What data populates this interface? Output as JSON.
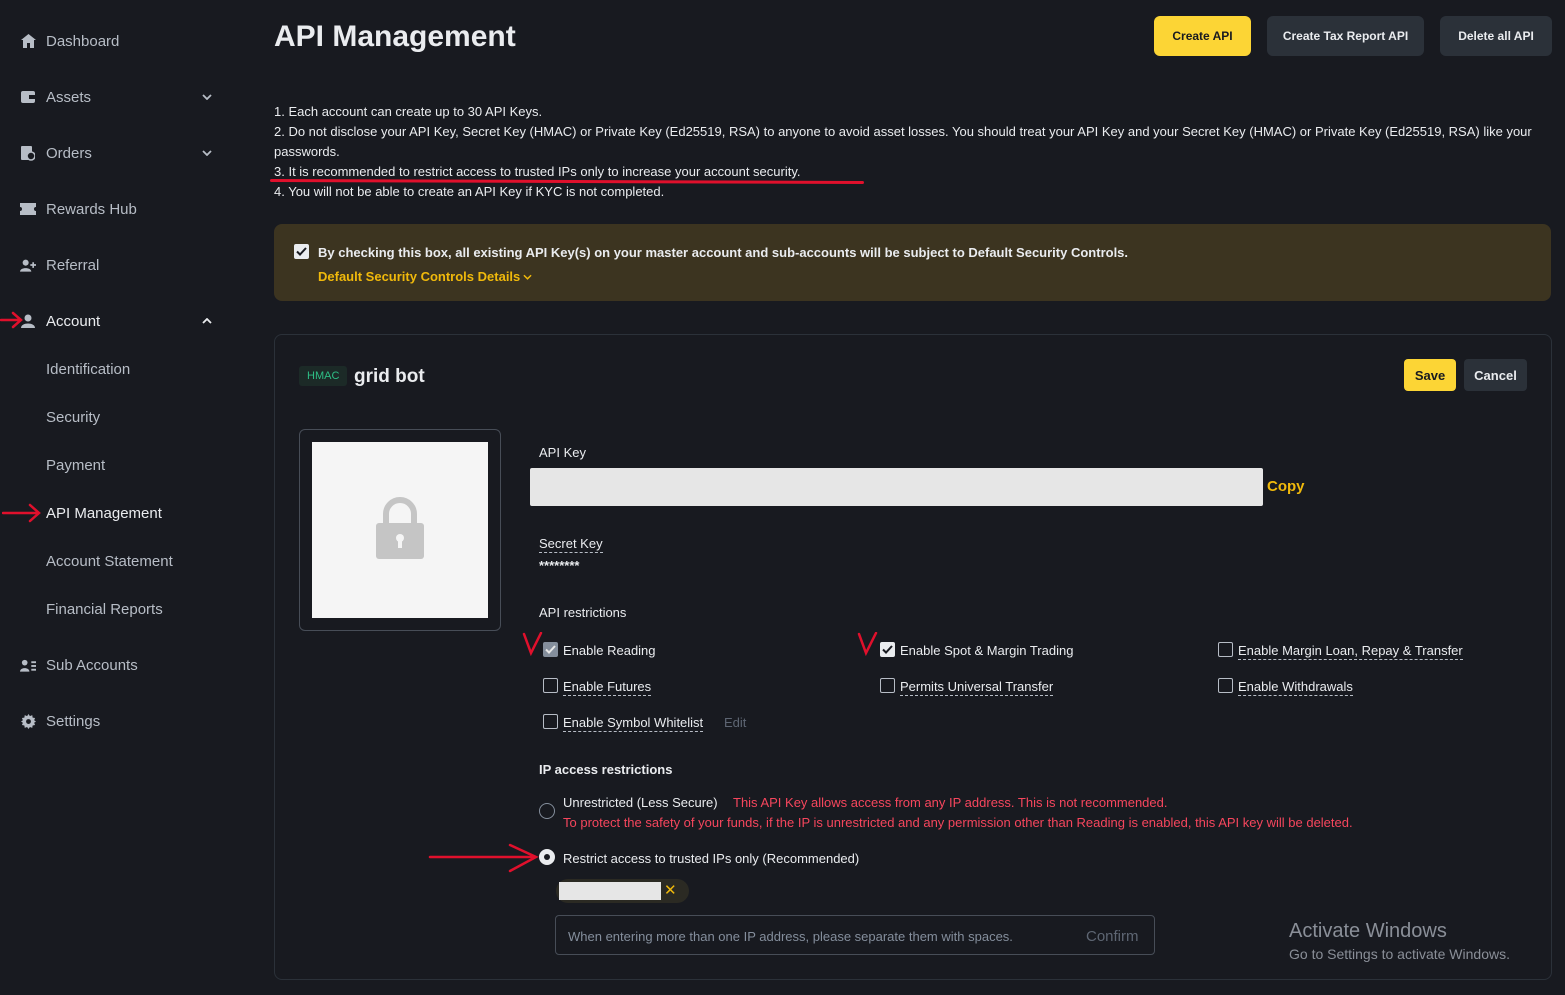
{
  "sidebar": {
    "items": [
      {
        "label": "Dashboard"
      },
      {
        "label": "Assets"
      },
      {
        "label": "Orders"
      },
      {
        "label": "Rewards Hub"
      },
      {
        "label": "Referral"
      },
      {
        "label": "Account"
      },
      {
        "label": "Identification"
      },
      {
        "label": "Security"
      },
      {
        "label": "Payment"
      },
      {
        "label": "API Management"
      },
      {
        "label": "Account Statement"
      },
      {
        "label": "Financial Reports"
      },
      {
        "label": "Sub Accounts"
      },
      {
        "label": "Settings"
      }
    ]
  },
  "header": {
    "title": "API Management",
    "create_api": "Create API",
    "create_tax": "Create Tax Report API",
    "delete_all": "Delete all API"
  },
  "notes": [
    "1. Each account can create up to 30 API Keys.",
    "2. Do not disclose your API Key, Secret Key (HMAC) or Private Key (Ed25519, RSA) to anyone to avoid asset losses. You should treat your API Key and your Secret Key (HMAC) or Private Key (Ed25519, RSA) like your passwords.",
    "3. It is recommended to restrict access to trusted IPs only to increase your account security.",
    "4. You will not be able to create an API Key if KYC is not completed."
  ],
  "notice": {
    "text": "By checking this box, all existing API Key(s) on your master account and sub-accounts will be subject to Default Security Controls.",
    "link": "Default Security Controls Details"
  },
  "card": {
    "badge": "HMAC",
    "name": "grid bot",
    "save": "Save",
    "cancel": "Cancel",
    "api_key_label": "API Key",
    "copy": "Copy",
    "secret_label": "Secret Key",
    "secret_value": "********",
    "restrictions_label": "API restrictions",
    "perms": {
      "reading": "Enable Reading",
      "spot": "Enable Spot & Margin Trading",
      "margin_loan": "Enable Margin Loan, Repay & Transfer",
      "futures": "Enable Futures",
      "universal": "Permits Universal Transfer",
      "withdrawals": "Enable Withdrawals",
      "whitelist": "Enable Symbol Whitelist",
      "edit": "Edit"
    },
    "ip_label": "IP access restrictions",
    "unrestricted": "Unrestricted (Less Secure)",
    "warn1": "This API Key allows access from any IP address. This is not recommended.",
    "warn2": "To protect the safety of your funds, if the IP is unrestricted and any permission other than Reading is enabled, this API key will be deleted.",
    "restricted": "Restrict access to trusted IPs only (Recommended)",
    "ip_placeholder": "When entering more than one IP address, please separate them with spaces.",
    "confirm": "Confirm"
  },
  "watermark": {
    "line1": "Activate Windows",
    "line2": "Go to Settings to activate Windows."
  },
  "colors": {
    "accent": "#fcd535",
    "link": "#f0b90b",
    "warning": "#f6465d",
    "annotation": "#e0102c"
  }
}
